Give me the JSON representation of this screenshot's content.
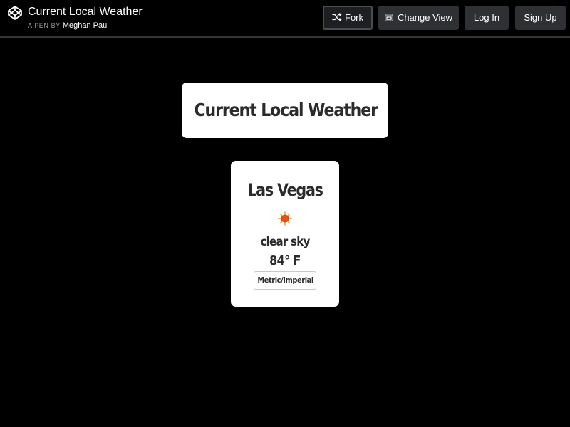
{
  "header": {
    "title": "Current Local Weather",
    "byline_label": "A PEN BY",
    "author": "Meghan Paul",
    "buttons": {
      "fork": "Fork",
      "change_view": "Change View",
      "login": "Log In",
      "signup": "Sign Up"
    }
  },
  "app": {
    "heading": "Current Local Weather",
    "weather": {
      "city": "Las Vegas",
      "icon": "sun-icon",
      "condition": "clear sky",
      "temperature": "84° F",
      "toggle_label": "Metric/Imperial"
    }
  },
  "colors": {
    "background": "#000000",
    "card": "#ffffff",
    "text": "#2b2b2b",
    "button": "#2f3033",
    "sun": "#e8501b"
  }
}
